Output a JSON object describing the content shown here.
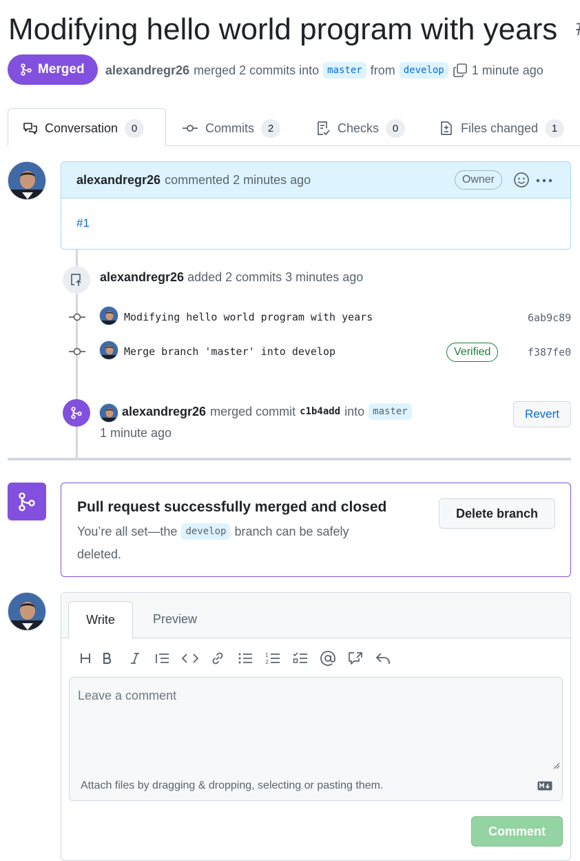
{
  "pr": {
    "title": "Modifying hello world program with years",
    "title_tail": "#",
    "status": "Merged",
    "author": "alexandregr26",
    "merge_text": "merged 2 commits into",
    "base_branch": "master",
    "from_text": "from",
    "head_branch": "develop",
    "time": "1 minute ago"
  },
  "tabs": [
    {
      "label": "Conversation",
      "count": "0",
      "icon": "comment-discussion-icon"
    },
    {
      "label": "Commits",
      "count": "2",
      "icon": "git-commit-icon"
    },
    {
      "label": "Checks",
      "count": "0",
      "icon": "checklist-icon"
    },
    {
      "label": "Files changed",
      "count": "1",
      "icon": "file-diff-icon"
    }
  ],
  "comment": {
    "author": "alexandregr26",
    "action": "commented 2 minutes ago",
    "role": "Owner",
    "body_link": "#1"
  },
  "commits_event": {
    "author": "alexandregr26",
    "text": "added 2 commits 3 minutes ago",
    "commits": [
      {
        "message": "Modifying hello world program with years",
        "sha": "6ab9c89",
        "verified": ""
      },
      {
        "message": "Merge branch 'master' into develop",
        "sha": "f387fe0",
        "verified": "Verified"
      }
    ]
  },
  "merge_event": {
    "author": "alexandregr26",
    "text": "merged commit",
    "commit": "c1b4add",
    "into": "into",
    "branch": "master",
    "time": "1 minute ago",
    "revert_label": "Revert"
  },
  "merged_box": {
    "title": "Pull request successfully merged and closed",
    "desc_pre": "You’re all set—the",
    "branch": "develop",
    "desc_post": "branch can be safely",
    "desc_end": "deleted.",
    "delete_label": "Delete branch"
  },
  "form": {
    "write_tab": "Write",
    "preview_tab": "Preview",
    "placeholder": "Leave a comment",
    "attach_text": "Attach files by dragging & dropping, selecting or pasting them.",
    "submit_label": "Comment"
  },
  "colors": {
    "merged": "#8250df",
    "link": "#0969da",
    "verified": "#1a7f37",
    "comment_button": "#94d3a2"
  }
}
